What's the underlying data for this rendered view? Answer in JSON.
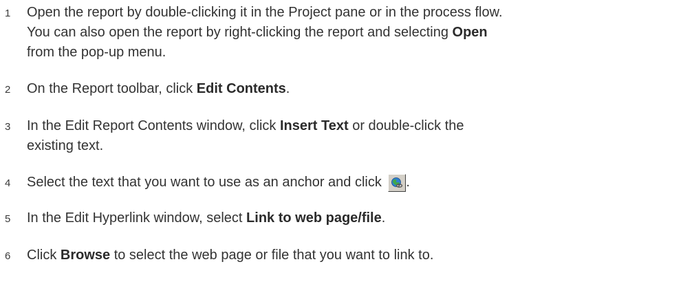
{
  "steps": [
    {
      "number": "1",
      "line1": "Open the report by double-clicking it in the Project pane or in the process flow.",
      "line2_pre": "You can also open the report by right-clicking the report and selecting ",
      "line2_bold": "Open",
      "line3": "from the pop-up menu."
    },
    {
      "number": "2",
      "pre": "On the Report toolbar, click ",
      "bold": "Edit Contents",
      "post": "."
    },
    {
      "number": "3",
      "pre": "In the Edit Report Contents window, click ",
      "bold": "Insert Text",
      "post": " or double-click the",
      "line2": "existing text."
    },
    {
      "number": "4",
      "pre": "Select the text that you want to use as an anchor and click ",
      "icon": "hyperlink-globe-icon",
      "post": "."
    },
    {
      "number": "5",
      "pre": "In the Edit Hyperlink window, select ",
      "bold": "Link to web page/file",
      "post": "."
    },
    {
      "number": "6",
      "pre": "Click ",
      "bold": "Browse",
      "post": " to select the web page or file that you want to link to."
    }
  ]
}
